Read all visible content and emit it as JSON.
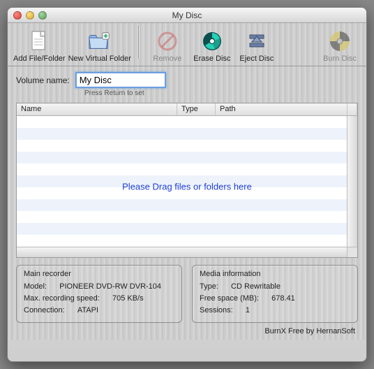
{
  "window": {
    "title": "My Disc"
  },
  "toolbar": {
    "add_file_folder": "Add File/Folder",
    "new_virtual_folder": "New Virtual Folder",
    "remove": "Remove",
    "erase_disc": "Erase Disc",
    "eject_disc": "Eject Disc",
    "burn_disc": "Burn Disc"
  },
  "volume": {
    "label": "Volume name:",
    "value": "My Disc",
    "hint": "Press Return to set"
  },
  "table": {
    "columns": {
      "name": "Name",
      "type": "Type",
      "path": "Path"
    },
    "empty_message": "Please Drag files or folders here"
  },
  "recorder": {
    "title": "Main recorder",
    "model_label": "Model:",
    "model_value": "PIONEER DVD-RW DVR-104",
    "speed_label": "Max. recording speed:",
    "speed_value": "705 KB/s",
    "conn_label": "Connection:",
    "conn_value": "ATAPI"
  },
  "media": {
    "title": "Media information",
    "type_label": "Type:",
    "type_value": "CD Rewritable",
    "free_label": "Free space (MB):",
    "free_value": "678.41",
    "sessions_label": "Sessions:",
    "sessions_value": "1"
  },
  "footer": "BurnX Free by HernanSoft"
}
